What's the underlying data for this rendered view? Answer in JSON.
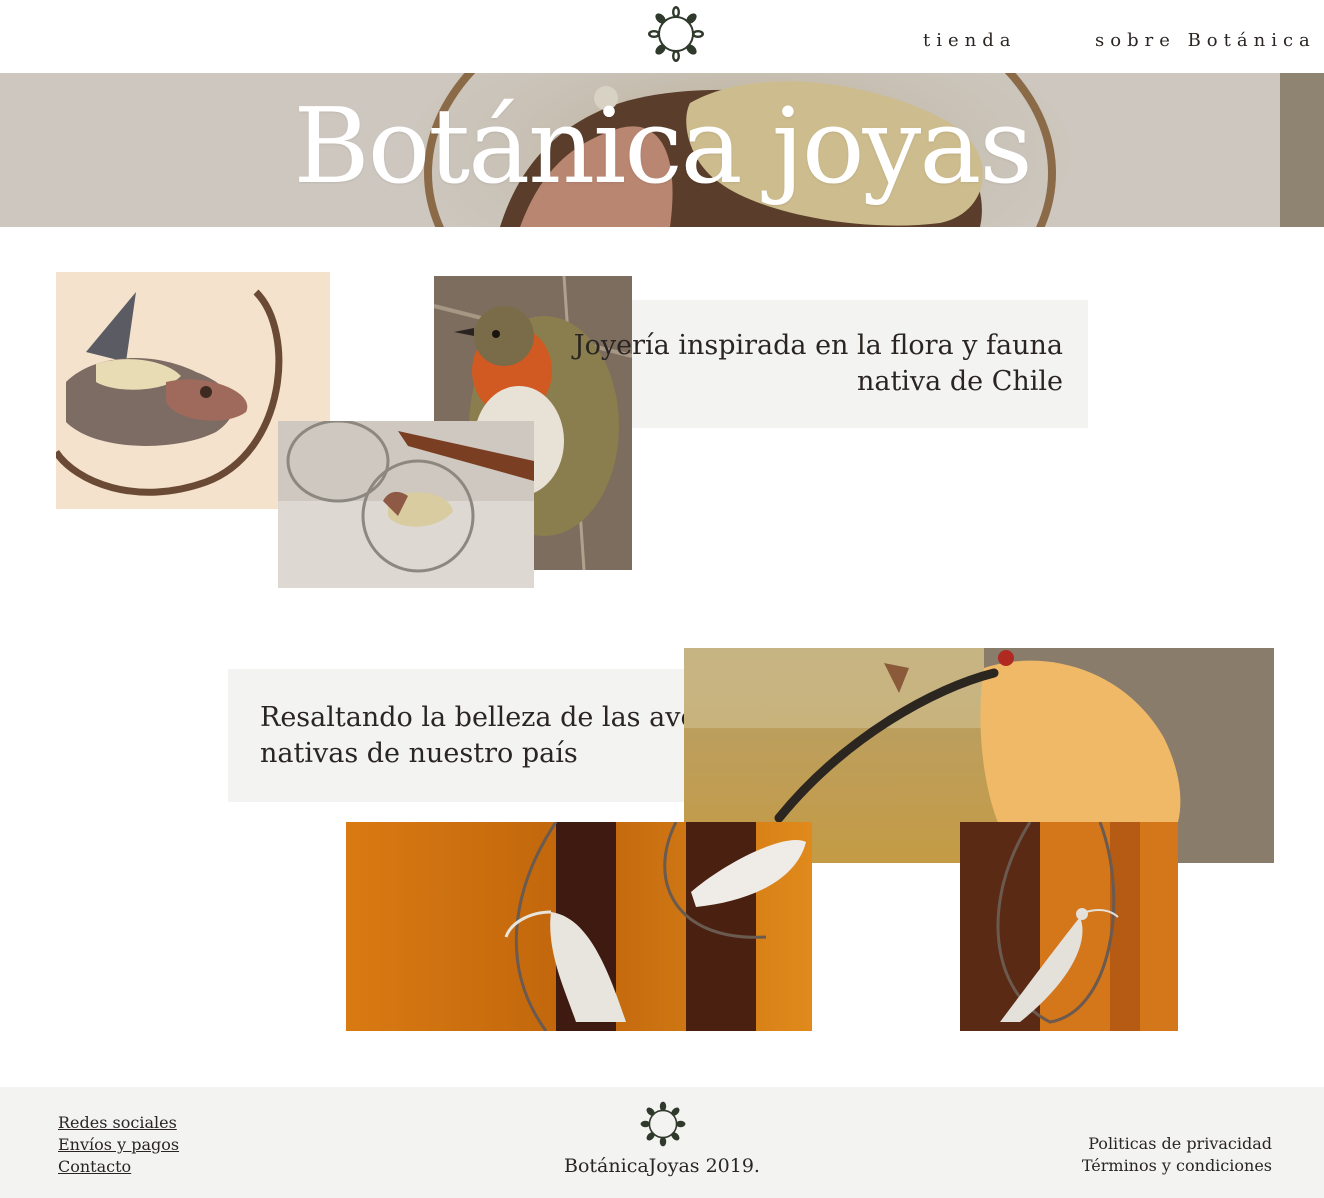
{
  "header": {
    "logo_icon": "wreath-leaf-logo-icon",
    "nav": [
      {
        "label": "tienda"
      },
      {
        "label": "sobre Botánica"
      }
    ]
  },
  "hero": {
    "title": "Botánica joyas"
  },
  "section1": {
    "text_line1": "Joyería inspirada en la flora y fauna",
    "text_line2": "nativa de Chile"
  },
  "section2": {
    "text_line1": "Resaltando la belleza de las aves",
    "text_line2": "nativas de nuestro país"
  },
  "footer": {
    "links_left": [
      "Redes sociales",
      "Envíos y pagos",
      "Contacto"
    ],
    "brand": "BotánicaJoyas 2019.",
    "links_right": [
      "Politicas de privacidad",
      "Términos y condiciones"
    ]
  },
  "colors": {
    "text": "#2a2522",
    "panel": "#f3f3f1",
    "logo": "#2f3a2c"
  }
}
